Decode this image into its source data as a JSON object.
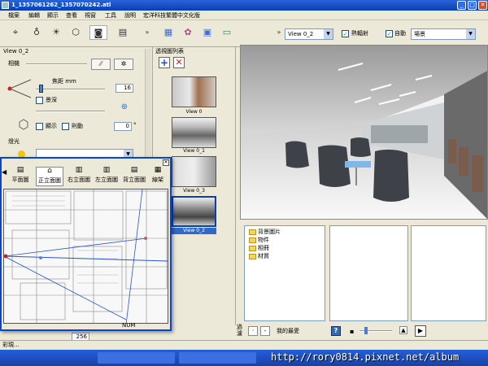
{
  "window": {
    "title": "1_1357061262_1357070242.atl",
    "min": "_",
    "max": "□",
    "close": "✕"
  },
  "menu": [
    "檔案",
    "編輯",
    "顯示",
    "查看",
    "視窗",
    "工具",
    "說明",
    "宏洋科技繁體中文化版"
  ],
  "toolbar": {
    "view_select": "View 0_2",
    "heat_radiation_label": "熱輻射",
    "auto_label": "自動",
    "scene_select": "場景"
  },
  "left": {
    "view_name": "View 0_2",
    "camera_label": "相機",
    "focal_label": "焦距 mm",
    "focal_value": "16",
    "depth_label": "景深",
    "show_label": "顯示",
    "link_label": "則動",
    "angle_value": "0",
    "angle_unit": "°",
    "light_label": "燈光",
    "bottom_value": "256"
  },
  "thumbs": {
    "header": "透視圖列表",
    "items": [
      {
        "label": "View 0"
      },
      {
        "label": "View 0_1"
      },
      {
        "label": "View 0_3"
      },
      {
        "label": "View 0_2"
      }
    ]
  },
  "tree": {
    "items": [
      "背景圖片",
      "物件",
      "相冊",
      "材質"
    ],
    "bottom_label": "我的最愛",
    "side_label": "過濾"
  },
  "floatwin": {
    "views": [
      "平面圖",
      "正立面圖",
      "右立面圖",
      "左立面圖",
      "背立面圖",
      "線架"
    ],
    "status": "NUM"
  },
  "statusbar": {
    "text": "彩現..."
  },
  "watermark": "http://rory0814.pixnet.net/album",
  "colors": {
    "title_blue": "#0a3fb4",
    "panel": "#ece9d8",
    "accent_red": "#cc2222"
  }
}
